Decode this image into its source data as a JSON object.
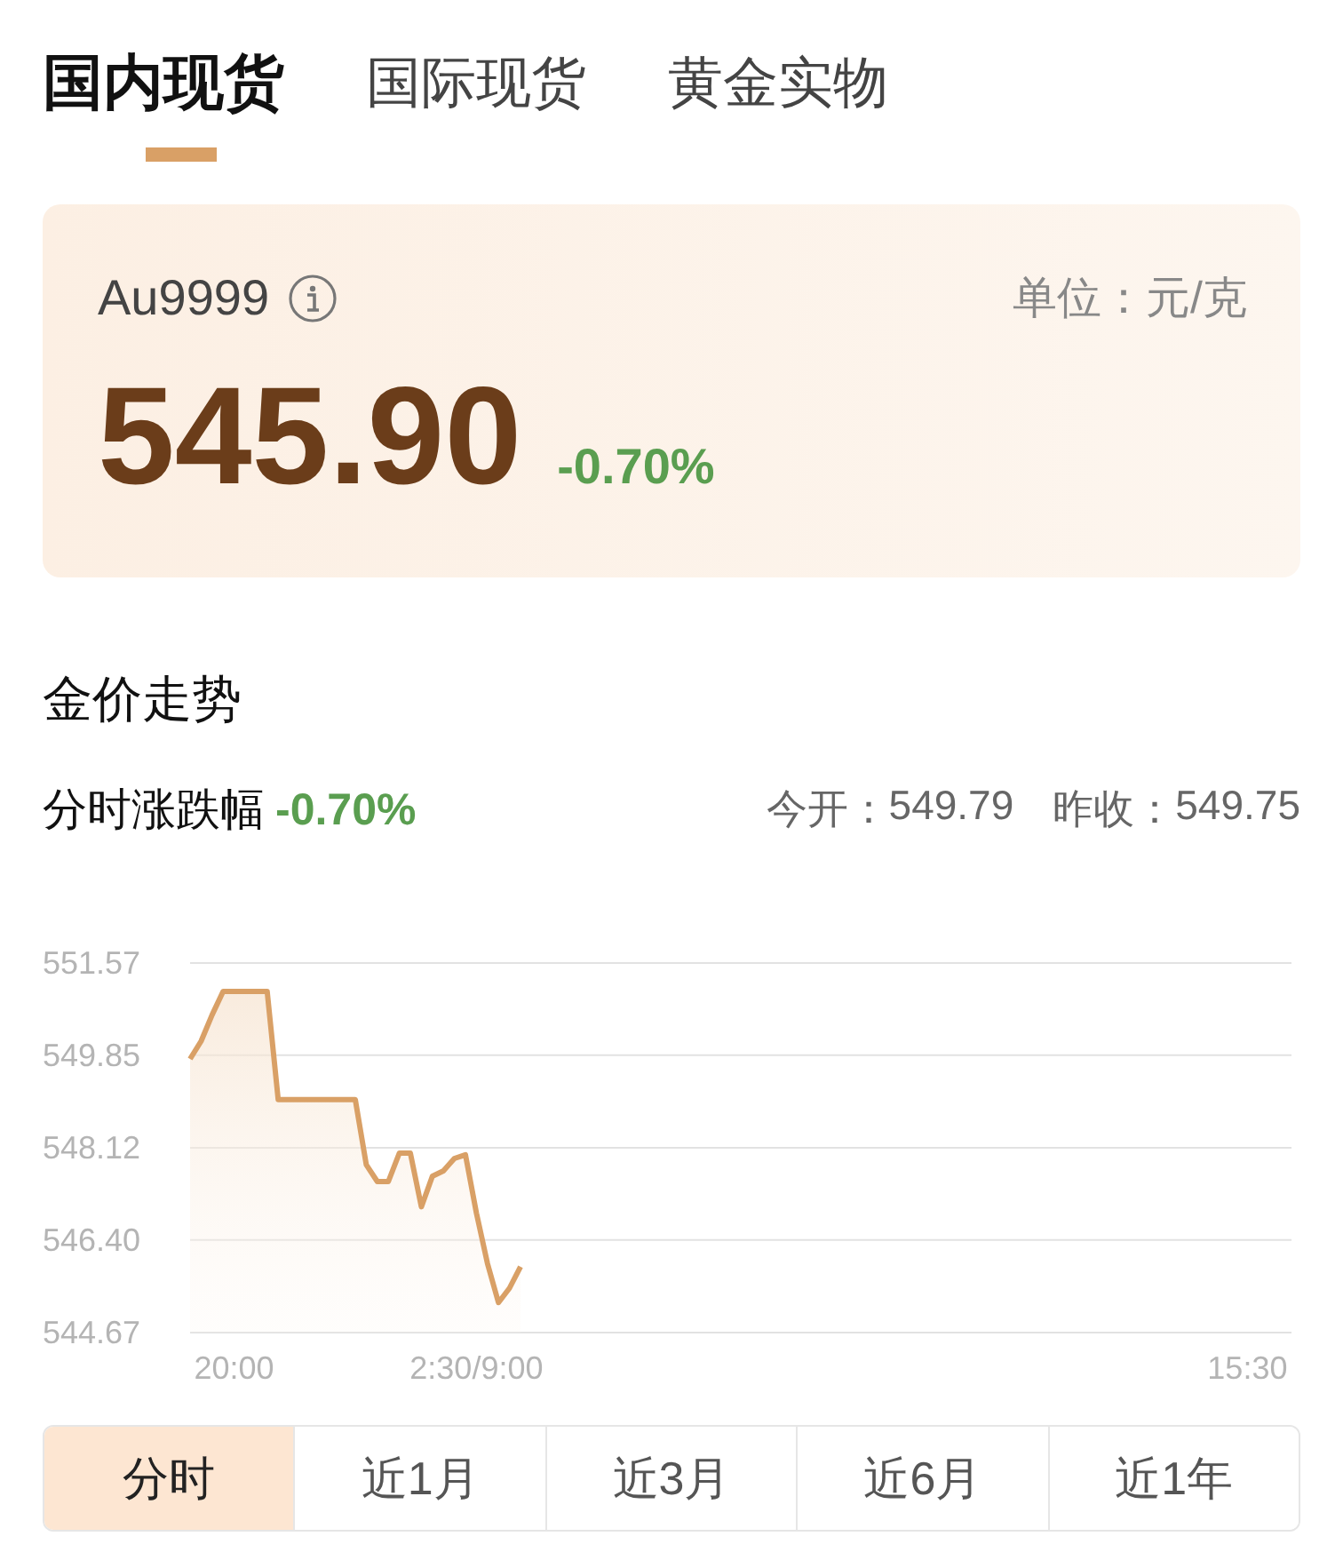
{
  "tabs": [
    {
      "label": "国内现货",
      "selected": true
    },
    {
      "label": "国际现货",
      "selected": false
    },
    {
      "label": "黄金实物",
      "selected": false
    }
  ],
  "quote": {
    "symbol": "Au9999",
    "unit": "单位：元/克",
    "price": "545.90",
    "change": "-0.70%"
  },
  "trend": {
    "title": "金价走势",
    "label": "分时涨跌幅",
    "change": "-0.70%",
    "open_label": "今开：",
    "open": "549.79",
    "prev_close_label": "昨收：",
    "prev_close": "549.75",
    "chart_data": {
      "type": "line",
      "grid": true,
      "categories": [
        null,
        null,
        null,
        null,
        "20:00",
        null,
        null,
        null,
        null,
        null,
        null,
        null,
        null,
        null,
        null,
        null,
        null,
        null,
        null,
        null,
        null,
        null,
        null,
        null,
        null,
        null,
        "2:30/9:00",
        null,
        null,
        null,
        null,
        null,
        null,
        null,
        null,
        null,
        null,
        null,
        null,
        null,
        null,
        null,
        null,
        null,
        null,
        null,
        null,
        null,
        null,
        null,
        null,
        null,
        null,
        null,
        null,
        null,
        null,
        null,
        null,
        null,
        null,
        null,
        null,
        null,
        null,
        null,
        null,
        null,
        null,
        null,
        null,
        null,
        null,
        null,
        null,
        null,
        null,
        null,
        null,
        null,
        null,
        null,
        null,
        null,
        null,
        null,
        null,
        null,
        null,
        null,
        null,
        null,
        null,
        null,
        null,
        null,
        "15:30",
        null,
        null,
        null,
        null
      ],
      "series": [
        {
          "color": "#d9a066",
          "values": [
            549.78,
            550.11,
            550.6,
            551.04,
            551.04,
            551.04,
            551.04,
            551.04,
            549.02,
            549.02,
            549.02,
            549.02,
            549.02,
            549.02,
            549.02,
            549.02,
            547.8,
            547.49,
            547.49,
            548.02,
            548.02,
            547.02,
            547.59,
            547.69,
            547.92,
            547.99,
            546.9,
            545.96,
            545.23,
            545.5,
            545.9,
            null,
            null,
            null,
            null,
            null,
            null,
            null,
            null,
            null,
            null,
            null,
            null,
            null,
            null,
            null,
            null,
            null,
            null,
            null,
            null,
            null,
            null,
            null,
            null,
            null,
            null,
            null,
            null,
            null,
            null,
            null,
            null,
            null,
            null,
            null,
            null,
            null,
            null,
            null,
            null,
            null,
            null,
            null,
            null,
            null,
            null,
            null,
            null,
            null,
            null,
            null,
            null,
            null,
            null,
            null,
            null,
            null,
            null,
            null,
            null,
            null,
            null,
            null,
            null,
            null,
            null,
            null,
            null,
            null,
            null
          ]
        }
      ],
      "ylim": [
        544.67,
        551.57
      ],
      "yticks": [
        {
          "value": 551.57,
          "label": "551.57"
        },
        {
          "value": 549.85,
          "label": "549.85"
        },
        {
          "value": 548.12,
          "label": "548.12"
        },
        {
          "value": 546.4,
          "label": "546.40"
        },
        {
          "value": 544.67,
          "label": "544.67"
        }
      ]
    }
  },
  "periods": [
    {
      "label": "分时",
      "selected": true
    },
    {
      "label": "近1月",
      "selected": false
    },
    {
      "label": "近3月",
      "selected": false
    },
    {
      "label": "近6月",
      "selected": false
    },
    {
      "label": "近1年",
      "selected": false
    }
  ]
}
